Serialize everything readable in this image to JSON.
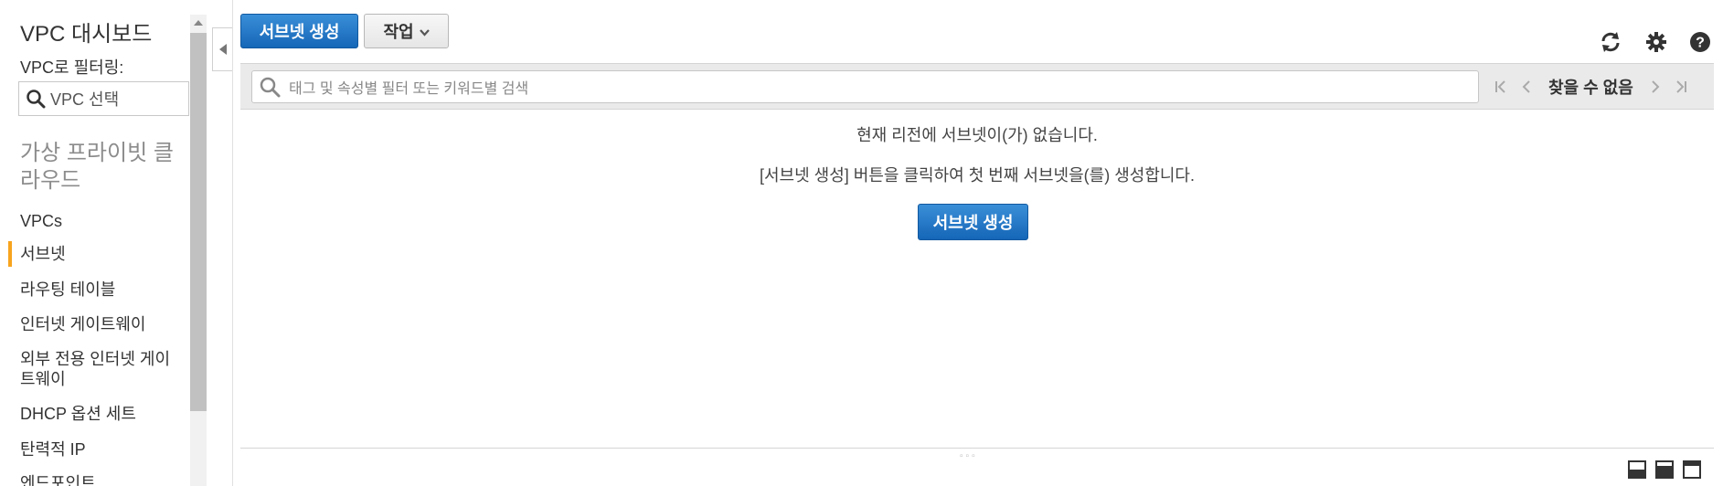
{
  "sidebar": {
    "title": "VPC 대시보드",
    "filter_label": "VPC로 필터링:",
    "vpc_select_placeholder": "VPC 선택",
    "section_title": "가상 프라이빗 클라우드",
    "items": [
      {
        "label": "VPCs"
      },
      {
        "label": "서브넷"
      },
      {
        "label": "라우팅 테이블"
      },
      {
        "label": "인터넷 게이트웨이"
      },
      {
        "label": "외부 전용 인터넷 게이트웨이"
      },
      {
        "label": "DHCP 옵션 세트"
      },
      {
        "label": "탄력적 IP"
      },
      {
        "label": "엔드포인트"
      }
    ],
    "active_item": "서브넷"
  },
  "toolbar": {
    "create_label": "서브넷 생성",
    "actions_label": "작업",
    "icons": [
      "refresh-icon",
      "gear-icon",
      "help-icon"
    ]
  },
  "filter": {
    "placeholder": "태그 및 속성별 필터 또는 키워드별 검색"
  },
  "pager": {
    "status": "찾을 수 없음"
  },
  "empty": {
    "message": "현재 리전에 서브넷이(가) 없습니다.",
    "instruction": "[서브넷 생성] 버튼을 클릭하여 첫 번째 서브넷을(를) 생성합니다.",
    "button_label": "서브넷 생성"
  },
  "colors": {
    "primary": "#1a73c9",
    "active_bar": "#f7a41d",
    "filterbar_bg": "#eaeaea"
  }
}
